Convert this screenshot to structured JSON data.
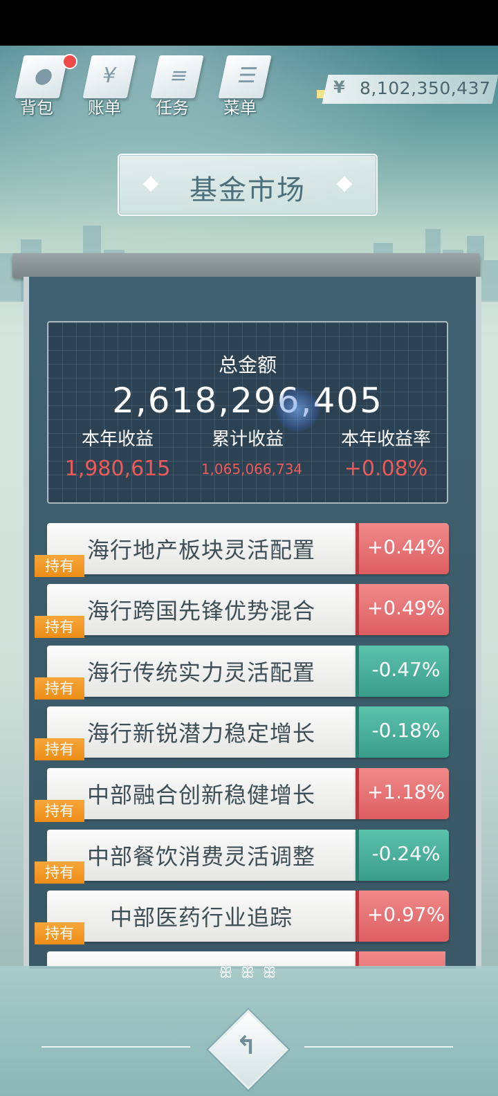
{
  "topbar": {
    "tools": [
      {
        "label": "背包",
        "icon": "bag-icon",
        "glyph": "●"
      },
      {
        "label": "账单",
        "icon": "bill-icon",
        "glyph": "¥"
      },
      {
        "label": "任务",
        "icon": "task-icon",
        "glyph": "≡"
      },
      {
        "label": "菜单",
        "icon": "menu-icon",
        "glyph": "☰"
      }
    ],
    "currency_symbol": "¥",
    "balance": "8,102,350,437"
  },
  "title": "基金市场",
  "summary": {
    "total_label": "总金额",
    "total_value": "2,618,296,405",
    "year_income_label": "本年收益",
    "year_income_value": "1,980,615",
    "cum_income_label": "累计收益",
    "cum_income_value": "1,065,066,734",
    "year_rate_label": "本年收益率",
    "year_rate_value": "+0.08%"
  },
  "funds": [
    {
      "name": "海行地产板块灵活配置",
      "change": "+0.44%",
      "trend": "up",
      "tag": "持有"
    },
    {
      "name": "海行跨国先锋优势混合",
      "change": "+0.49%",
      "trend": "up",
      "tag": "持有"
    },
    {
      "name": "海行传统实力灵活配置",
      "change": "-0.47%",
      "trend": "down",
      "tag": "持有"
    },
    {
      "name": "海行新锐潜力稳定增长",
      "change": "-0.18%",
      "trend": "down",
      "tag": "持有"
    },
    {
      "name": "中部融合创新稳健增长",
      "change": "+1.18%",
      "trend": "up",
      "tag": "持有"
    },
    {
      "name": "中部餐饮消费灵活调整",
      "change": "-0.24%",
      "trend": "down",
      "tag": "持有"
    },
    {
      "name": "中部医药行业追踪",
      "change": "+0.97%",
      "trend": "up",
      "tag": "持有"
    }
  ],
  "colors": {
    "up": "#dd5e62",
    "down": "#3a9d8a",
    "tag": "#ee8d17",
    "income": "#ef5a5a"
  },
  "bottom": {
    "ornament": "ꕥ ꕥ ꕥ",
    "back_icon": "back-arrow-icon",
    "back_glyph": "↰"
  }
}
